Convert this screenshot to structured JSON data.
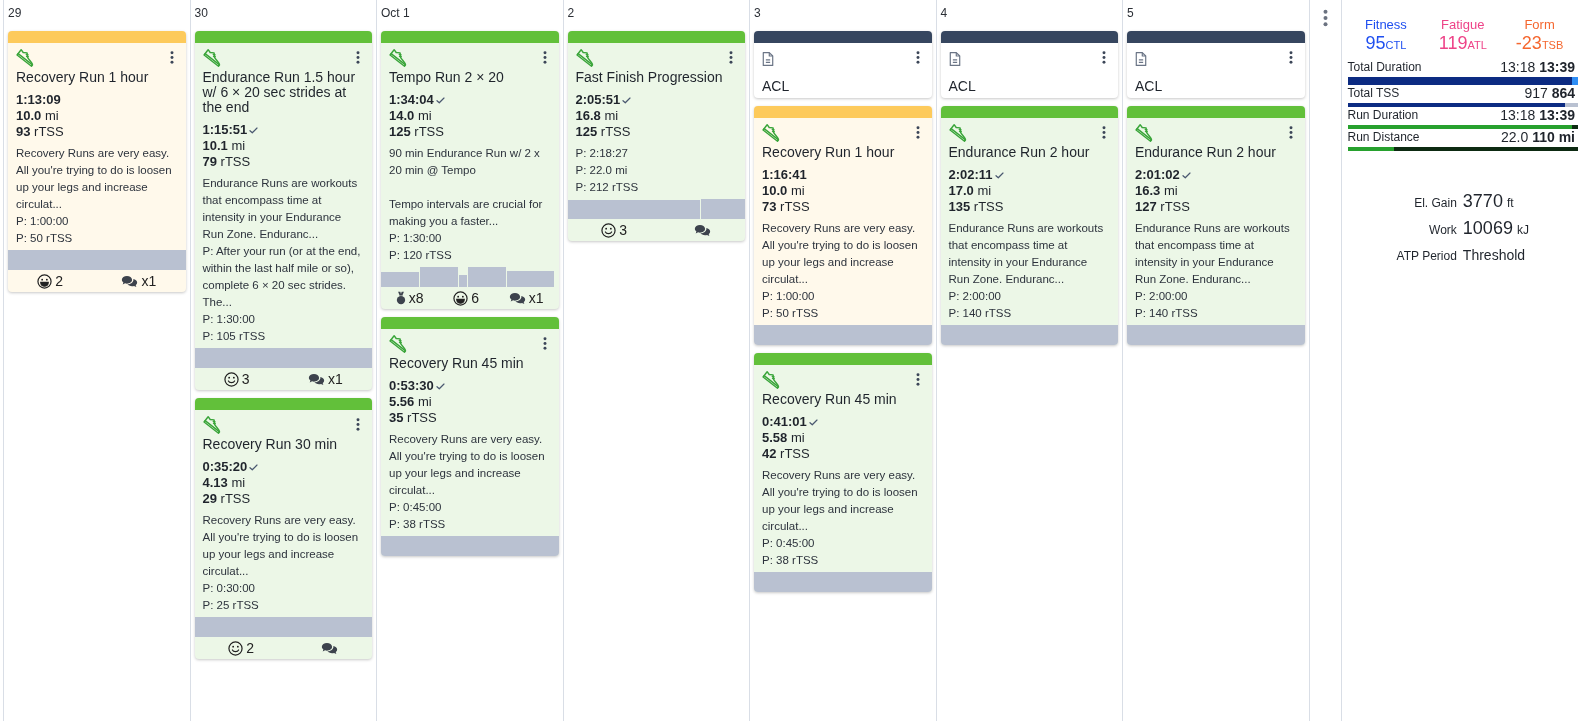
{
  "days": [
    {
      "date": "29",
      "cards": [
        {
          "kind": "workout",
          "color": "#fdca5b",
          "title": "Recovery Run 1 hour",
          "duration": "1:13:09",
          "completed": false,
          "distance": "**10.0** mi",
          "tss": "**93** rTSS",
          "description": "Recovery Runs are very easy. All you're trying to do is loosen up your legs and increase circulat...",
          "planned": [
            "P: 1:00:00",
            "P: 50 rTSS"
          ],
          "graph": {
            "kind": "steady"
          },
          "footer": [
            {
              "kind": "grin",
              "text": "2"
            },
            {
              "kind": "comments",
              "text": "x1"
            }
          ]
        }
      ]
    },
    {
      "date": "30",
      "cards": [
        {
          "kind": "workout",
          "color": "#62c03a",
          "title": "Endurance Run 1.5 hour w/ 6 × 20 sec strides at the end",
          "duration": "1:15:51",
          "completed": true,
          "distance": "**10.1** mi",
          "tss": "**79** rTSS",
          "description": "Endurance Runs are workouts that encompass time at intensity in your Endurance Run Zone. Enduranc...",
          "planned": [
            "P: After your run (or at the end, within the last half mile or so), complete 6 × 20 sec strides. The...",
            "P: 1:30:00",
            "P: 105 rTSS"
          ],
          "graph": {
            "kind": "steady"
          },
          "footer": [
            {
              "kind": "smile",
              "text": "3"
            },
            {
              "kind": "comments",
              "text": "x1"
            }
          ]
        },
        {
          "kind": "workout",
          "color": "#62c03a",
          "title": "Recovery Run 30 min",
          "duration": "0:35:20",
          "completed": true,
          "distance": "**4.13** mi",
          "tss": "**29** rTSS",
          "description": "Recovery Runs are very easy. All you're trying to do is loosen up your legs and increase circulat...",
          "planned": [
            "P: 0:30:00",
            "P: 25 rTSS"
          ],
          "graph": {
            "kind": "steady"
          },
          "footer": [
            {
              "kind": "smile",
              "text": "2"
            },
            {
              "kind": "comments"
            }
          ]
        }
      ]
    },
    {
      "date": "Oct 1",
      "cards": [
        {
          "kind": "workout",
          "color": "#62c03a",
          "title": "Tempo Run 2 × 20",
          "duration": "1:34:04",
          "completed": true,
          "distance": "**14.0** mi",
          "tss": "**125** rTSS",
          "description": "90 min Endurance Run w/ 2 x 20 min @ Tempo\n\nTempo intervals are crucial for making you a faster...",
          "planned": [
            "P: 1:30:00",
            "P: 120 rTSS"
          ],
          "graph": {
            "kind": "intervals"
          },
          "footer": [
            {
              "kind": "medal",
              "text": "x8"
            },
            {
              "kind": "grin",
              "text": "6"
            },
            {
              "kind": "comments",
              "text": "x1"
            }
          ]
        },
        {
          "kind": "workout",
          "color": "#62c03a",
          "title": "Recovery Run 45 min",
          "duration": "0:53:30",
          "completed": true,
          "distance": "**5.56** mi",
          "tss": "**35** rTSS",
          "description": "Recovery Runs are very easy. All you're trying to do is loosen up your legs and increase circulat...",
          "planned": [
            "P: 0:45:00",
            "P: 38 rTSS"
          ],
          "graph": {
            "kind": "steady"
          }
        }
      ]
    },
    {
      "date": "2",
      "cards": [
        {
          "kind": "workout",
          "color": "#62c03a",
          "title": "Fast Finish Progression",
          "duration": "2:05:51",
          "completed": true,
          "distance": "**16.8** mi",
          "tss": "**125** rTSS",
          "planned": [
            "P: 2:18:27",
            "P: 22.0 mi",
            "P: 212 rTSS"
          ],
          "graph": {
            "kind": "progression"
          },
          "footer": [
            {
              "kind": "smile",
              "text": "3"
            },
            {
              "kind": "comments"
            }
          ]
        }
      ]
    },
    {
      "date": "3",
      "cards": [
        {
          "kind": "note",
          "color": "#36465f",
          "title": "ACL"
        },
        {
          "kind": "workout",
          "color": "#fdca5b",
          "title": "Recovery Run 1 hour",
          "duration": "1:16:41",
          "completed": false,
          "distance": "**10.0** mi",
          "tss": "**73** rTSS",
          "description": "Recovery Runs are very easy. All you're trying to do is loosen up your legs and increase circulat...",
          "planned": [
            "P: 1:00:00",
            "P: 50 rTSS"
          ],
          "graph": {
            "kind": "steady"
          }
        },
        {
          "kind": "workout",
          "color": "#62c03a",
          "title": "Recovery Run 45 min",
          "duration": "0:41:01",
          "completed": true,
          "distance": "**5.58** mi",
          "tss": "**42** rTSS",
          "description": "Recovery Runs are very easy. All you're trying to do is loosen up your legs and increase circulat...",
          "planned": [
            "P: 0:45:00",
            "P: 38 rTSS"
          ],
          "graph": {
            "kind": "steady"
          }
        }
      ]
    },
    {
      "date": "4",
      "cards": [
        {
          "kind": "note",
          "color": "#36465f",
          "title": "ACL"
        },
        {
          "kind": "workout",
          "color": "#62c03a",
          "title": "Endurance Run 2 hour",
          "duration": "2:02:11",
          "completed": true,
          "distance": "**17.0** mi",
          "tss": "**135** rTSS",
          "description": "Endurance Runs are workouts that encompass time at intensity in your Endurance Run Zone. Enduranc...",
          "planned": [
            "P: 2:00:00",
            "P: 140 rTSS"
          ],
          "graph": {
            "kind": "steady"
          }
        }
      ]
    },
    {
      "date": "5",
      "cards": [
        {
          "kind": "note",
          "color": "#36465f",
          "title": "ACL"
        },
        {
          "kind": "workout",
          "color": "#62c03a",
          "title": "Endurance Run 2 hour",
          "duration": "2:01:02",
          "completed": true,
          "distance": "**16.3** mi",
          "tss": "**127** rTSS",
          "description": "Endurance Runs are workouts that encompass time at intensity in your Endurance Run Zone. Enduranc...",
          "planned": [
            "P: 2:00:00",
            "P: 140 rTSS"
          ],
          "graph": {
            "kind": "steady"
          }
        }
      ]
    }
  ],
  "summary": {
    "form": [
      {
        "label": "Fitness",
        "value": "95",
        "unit": "CTL",
        "color": "#1f4ff0"
      },
      {
        "label": "Fatigue",
        "value": "119",
        "unit": "ATL",
        "color": "#ee4388"
      },
      {
        "label": "Form",
        "value": "-23",
        "unit": "TSB",
        "color": "#f5672f"
      }
    ],
    "metrics": [
      {
        "label": "Total Duration",
        "value": "13:18 **13:39**",
        "segments": [
          {
            "color": "#0c2b82",
            "level": 0.974
          },
          {
            "color": "#2e8ef5",
            "level": 0.026
          }
        ]
      },
      {
        "label": "Total TSS",
        "value": "917 **864**",
        "segments": [
          {
            "color": "#0c2b82",
            "level": 0.943
          },
          {
            "color": "#b9c1d1",
            "level": 0.057
          }
        ]
      },
      {
        "label": "Run Duration",
        "value": "13:18 **13:39**",
        "segments": [
          {
            "color": "#27a12e",
            "level": 0.974
          },
          {
            "color": "#0d2a12",
            "level": 0.026
          }
        ]
      },
      {
        "label": "Run Distance",
        "value": "22.0 **110 mi**",
        "segments": [
          {
            "color": "#27a12e",
            "level": 0.2
          },
          {
            "color": "#0d2a12",
            "level": 0.8
          }
        ]
      }
    ],
    "details": [
      {
        "label": "El. Gain",
        "value": "3770",
        "unit": "ft"
      },
      {
        "label": "Work",
        "value": "10069",
        "unit": "kJ"
      },
      {
        "label": "ATP Period",
        "value": "Threshold"
      }
    ]
  }
}
